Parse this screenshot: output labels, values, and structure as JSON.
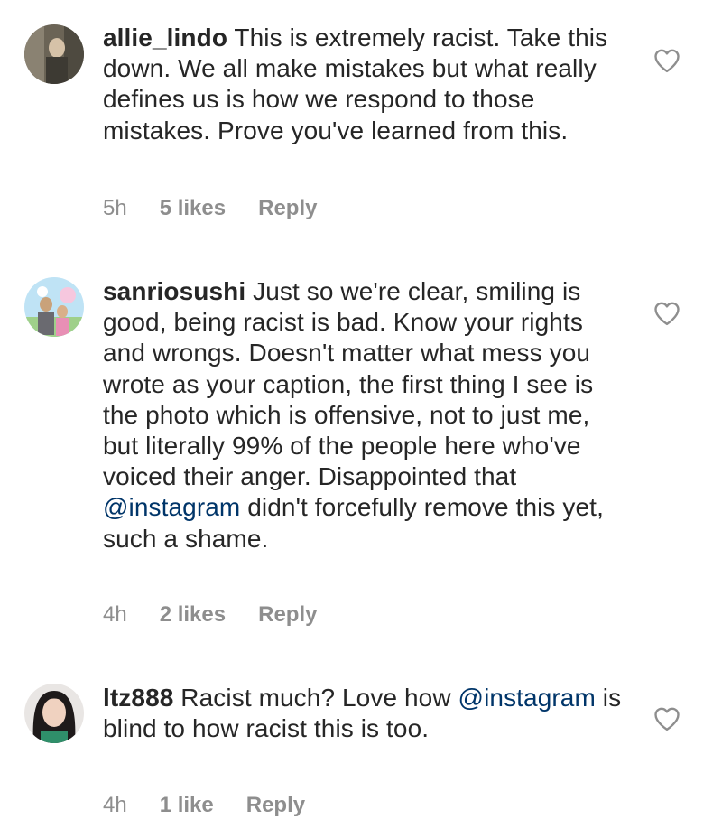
{
  "comments": [
    {
      "username": "allie_lindo",
      "text_parts": [
        {
          "type": "text",
          "value": " This is extremely racist. Take this down. We all make mistakes but what really defines us is how we respond to those mistakes. Prove you've learned from this."
        }
      ],
      "time": "5h",
      "likes": "5 likes",
      "reply": "Reply"
    },
    {
      "username": "sanriosushi",
      "text_parts": [
        {
          "type": "text",
          "value": " Just so we're clear, smiling is good, being racist is bad. Know your rights and wrongs. Doesn't matter what mess you wrote as your caption, the first thing I see is the photo which is offensive, not to just me, but literally 99% of the people here who've voiced their anger. Disappointed that "
        },
        {
          "type": "mention",
          "value": "@instagram"
        },
        {
          "type": "text",
          "value": " didn't forcefully remove this yet, such a shame."
        }
      ],
      "time": "4h",
      "likes": "2 likes",
      "reply": "Reply"
    },
    {
      "username": "ltz888",
      "text_parts": [
        {
          "type": "text",
          "value": " Racist much? Love how "
        },
        {
          "type": "mention",
          "value": "@instagram"
        },
        {
          "type": "text",
          "value": " is blind to how racist this is too."
        }
      ],
      "time": "4h",
      "likes": "1 like",
      "reply": "Reply"
    }
  ],
  "icons": {
    "like": "heart-outline-icon"
  },
  "colors": {
    "text": "#262626",
    "meta": "#8e8e8e",
    "mention": "#003569"
  }
}
